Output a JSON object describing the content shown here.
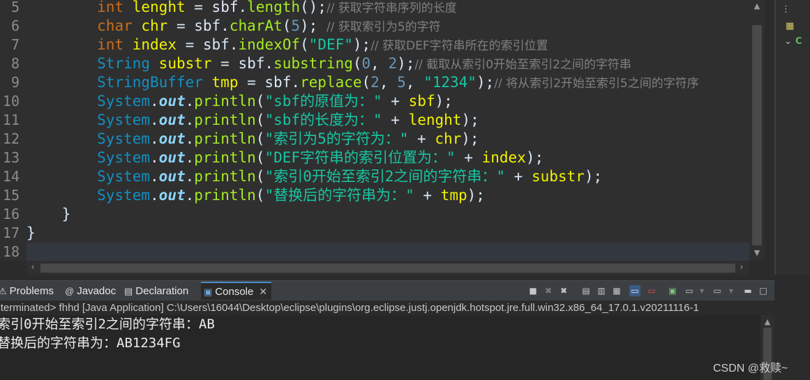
{
  "editor": {
    "lines": [
      {
        "num": "5",
        "tokens": [
          {
            "t": "        "
          },
          {
            "t": "int",
            "c": "kw"
          },
          {
            "t": " "
          },
          {
            "t": "lenght",
            "c": "var"
          },
          {
            "t": " = "
          },
          {
            "t": "sbf",
            "c": "pl"
          },
          {
            "t": "."
          },
          {
            "t": "length",
            "c": "fn"
          },
          {
            "t": "();"
          },
          {
            "t": "// 获取字符串序列的长度",
            "c": "cmt"
          }
        ]
      },
      {
        "num": "6",
        "tokens": [
          {
            "t": "        "
          },
          {
            "t": "char",
            "c": "kw"
          },
          {
            "t": " "
          },
          {
            "t": "chr",
            "c": "var"
          },
          {
            "t": " = "
          },
          {
            "t": "sbf"
          },
          {
            "t": "."
          },
          {
            "t": "charAt",
            "c": "fn"
          },
          {
            "t": "("
          },
          {
            "t": "5",
            "c": "num"
          },
          {
            "t": "); "
          },
          {
            "t": "// 获取索引为5的字符",
            "c": "cmt"
          }
        ]
      },
      {
        "num": "7",
        "tokens": [
          {
            "t": "        "
          },
          {
            "t": "int",
            "c": "kw"
          },
          {
            "t": " "
          },
          {
            "t": "index",
            "c": "var"
          },
          {
            "t": " = "
          },
          {
            "t": "sbf"
          },
          {
            "t": "."
          },
          {
            "t": "indexOf",
            "c": "fn"
          },
          {
            "t": "("
          },
          {
            "t": "\"DEF\"",
            "c": "str"
          },
          {
            "t": ");"
          },
          {
            "t": "// 获取DEF字符串所在的索引位置",
            "c": "cmt"
          }
        ]
      },
      {
        "num": "8",
        "tokens": [
          {
            "t": "        "
          },
          {
            "t": "String",
            "c": "ty"
          },
          {
            "t": " "
          },
          {
            "t": "substr",
            "c": "var"
          },
          {
            "t": " = "
          },
          {
            "t": "sbf"
          },
          {
            "t": "."
          },
          {
            "t": "substring",
            "c": "fn"
          },
          {
            "t": "("
          },
          {
            "t": "0",
            "c": "num"
          },
          {
            "t": ", "
          },
          {
            "t": "2",
            "c": "num"
          },
          {
            "t": ");"
          },
          {
            "t": "// 截取从索引0开始至索引2之间的字符串",
            "c": "cmt"
          }
        ]
      },
      {
        "num": "9",
        "tokens": [
          {
            "t": "        "
          },
          {
            "t": "StringBuffer",
            "c": "ty"
          },
          {
            "t": " "
          },
          {
            "t": "tmp",
            "c": "var"
          },
          {
            "t": " = "
          },
          {
            "t": "sbf"
          },
          {
            "t": "."
          },
          {
            "t": "replace",
            "c": "fn"
          },
          {
            "t": "("
          },
          {
            "t": "2",
            "c": "num"
          },
          {
            "t": ", "
          },
          {
            "t": "5",
            "c": "num"
          },
          {
            "t": ", "
          },
          {
            "t": "\"1234\"",
            "c": "str"
          },
          {
            "t": ");"
          },
          {
            "t": "// 将从索引2开始至索引5之间的字符序",
            "c": "cmt"
          }
        ]
      },
      {
        "num": "10",
        "tokens": [
          {
            "t": "        "
          },
          {
            "t": "System",
            "c": "ty"
          },
          {
            "t": "."
          },
          {
            "t": "out",
            "c": "fld"
          },
          {
            "t": "."
          },
          {
            "t": "println",
            "c": "fn"
          },
          {
            "t": "("
          },
          {
            "t": "\"sbf的原值为：\"",
            "c": "str"
          },
          {
            "t": " + "
          },
          {
            "t": "sbf",
            "c": "var"
          },
          {
            "t": ");"
          }
        ]
      },
      {
        "num": "11",
        "tokens": [
          {
            "t": "        "
          },
          {
            "t": "System",
            "c": "ty"
          },
          {
            "t": "."
          },
          {
            "t": "out",
            "c": "fld"
          },
          {
            "t": "."
          },
          {
            "t": "println",
            "c": "fn"
          },
          {
            "t": "("
          },
          {
            "t": "\"sbf的长度为：\"",
            "c": "str"
          },
          {
            "t": " + "
          },
          {
            "t": "lenght",
            "c": "var"
          },
          {
            "t": ");"
          }
        ]
      },
      {
        "num": "12",
        "tokens": [
          {
            "t": "        "
          },
          {
            "t": "System",
            "c": "ty"
          },
          {
            "t": "."
          },
          {
            "t": "out",
            "c": "fld"
          },
          {
            "t": "."
          },
          {
            "t": "println",
            "c": "fn"
          },
          {
            "t": "("
          },
          {
            "t": "\"索引为5的字符为：\"",
            "c": "str"
          },
          {
            "t": " + "
          },
          {
            "t": "chr",
            "c": "var"
          },
          {
            "t": ");"
          }
        ]
      },
      {
        "num": "13",
        "tokens": [
          {
            "t": "        "
          },
          {
            "t": "System",
            "c": "ty"
          },
          {
            "t": "."
          },
          {
            "t": "out",
            "c": "fld"
          },
          {
            "t": "."
          },
          {
            "t": "println",
            "c": "fn"
          },
          {
            "t": "("
          },
          {
            "t": "\"DEF字符串的索引位置为：\"",
            "c": "str"
          },
          {
            "t": " + "
          },
          {
            "t": "index",
            "c": "var"
          },
          {
            "t": ");"
          }
        ]
      },
      {
        "num": "14",
        "tokens": [
          {
            "t": "        "
          },
          {
            "t": "System",
            "c": "ty"
          },
          {
            "t": "."
          },
          {
            "t": "out",
            "c": "fld"
          },
          {
            "t": "."
          },
          {
            "t": "println",
            "c": "fn"
          },
          {
            "t": "("
          },
          {
            "t": "\"索引0开始至索引2之间的字符串：\"",
            "c": "str"
          },
          {
            "t": " + "
          },
          {
            "t": "substr",
            "c": "var"
          },
          {
            "t": ");"
          }
        ]
      },
      {
        "num": "15",
        "tokens": [
          {
            "t": "        "
          },
          {
            "t": "System",
            "c": "ty"
          },
          {
            "t": "."
          },
          {
            "t": "out",
            "c": "fld"
          },
          {
            "t": "."
          },
          {
            "t": "println",
            "c": "fn"
          },
          {
            "t": "("
          },
          {
            "t": "\"替换后的字符串为：\"",
            "c": "str"
          },
          {
            "t": " + "
          },
          {
            "t": "tmp",
            "c": "var"
          },
          {
            "t": ");"
          }
        ]
      },
      {
        "num": "16",
        "tokens": [
          {
            "t": "    }"
          }
        ]
      },
      {
        "num": "17",
        "tokens": [
          {
            "t": "}"
          }
        ]
      },
      {
        "num": "18",
        "tokens": [
          {
            "t": ""
          }
        ],
        "current": true
      }
    ]
  },
  "bottom_tabs": [
    {
      "label": "Problems",
      "icon": "problems-icon",
      "glyph": "⚠"
    },
    {
      "label": "Javadoc",
      "icon": "javadoc-icon",
      "glyph": "@"
    },
    {
      "label": "Declaration",
      "icon": "declaration-icon",
      "glyph": "▤"
    },
    {
      "label": "Console",
      "icon": "console-icon",
      "glyph": "▣",
      "active": true
    }
  ],
  "console": {
    "status": "<terminated> fhhd [Java Application] C:\\Users\\16044\\Desktop\\eclipse\\plugins\\org.eclipse.justj.openjdk.hotspot.jre.full.win32.x86_64_17.0.1.v20211116-1",
    "output": [
      "索引0开始至索引2之间的字符串：AB",
      "替换后的字符串为：AB1234FG"
    ]
  },
  "watermark": "CSDN @救赎~",
  "colors": {
    "editor_bg": "#2f2f2f",
    "console_bg": "#262626",
    "accent": "#4b8ec8"
  }
}
